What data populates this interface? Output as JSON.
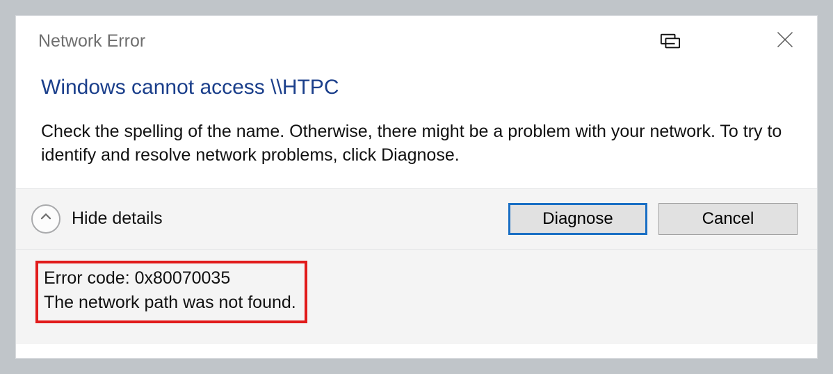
{
  "titlebar": {
    "title": "Network Error"
  },
  "content": {
    "headline": "Windows cannot access \\\\HTPC",
    "body": "Check the spelling of the name. Otherwise, there might be a problem with your network. To try to identify and resolve network problems, click Diagnose."
  },
  "actions": {
    "toggle_label": "Hide details",
    "diagnose_label": "Diagnose",
    "cancel_label": "Cancel"
  },
  "details": {
    "line1": "Error code: 0x80070035",
    "line2": "The network path was not found."
  }
}
